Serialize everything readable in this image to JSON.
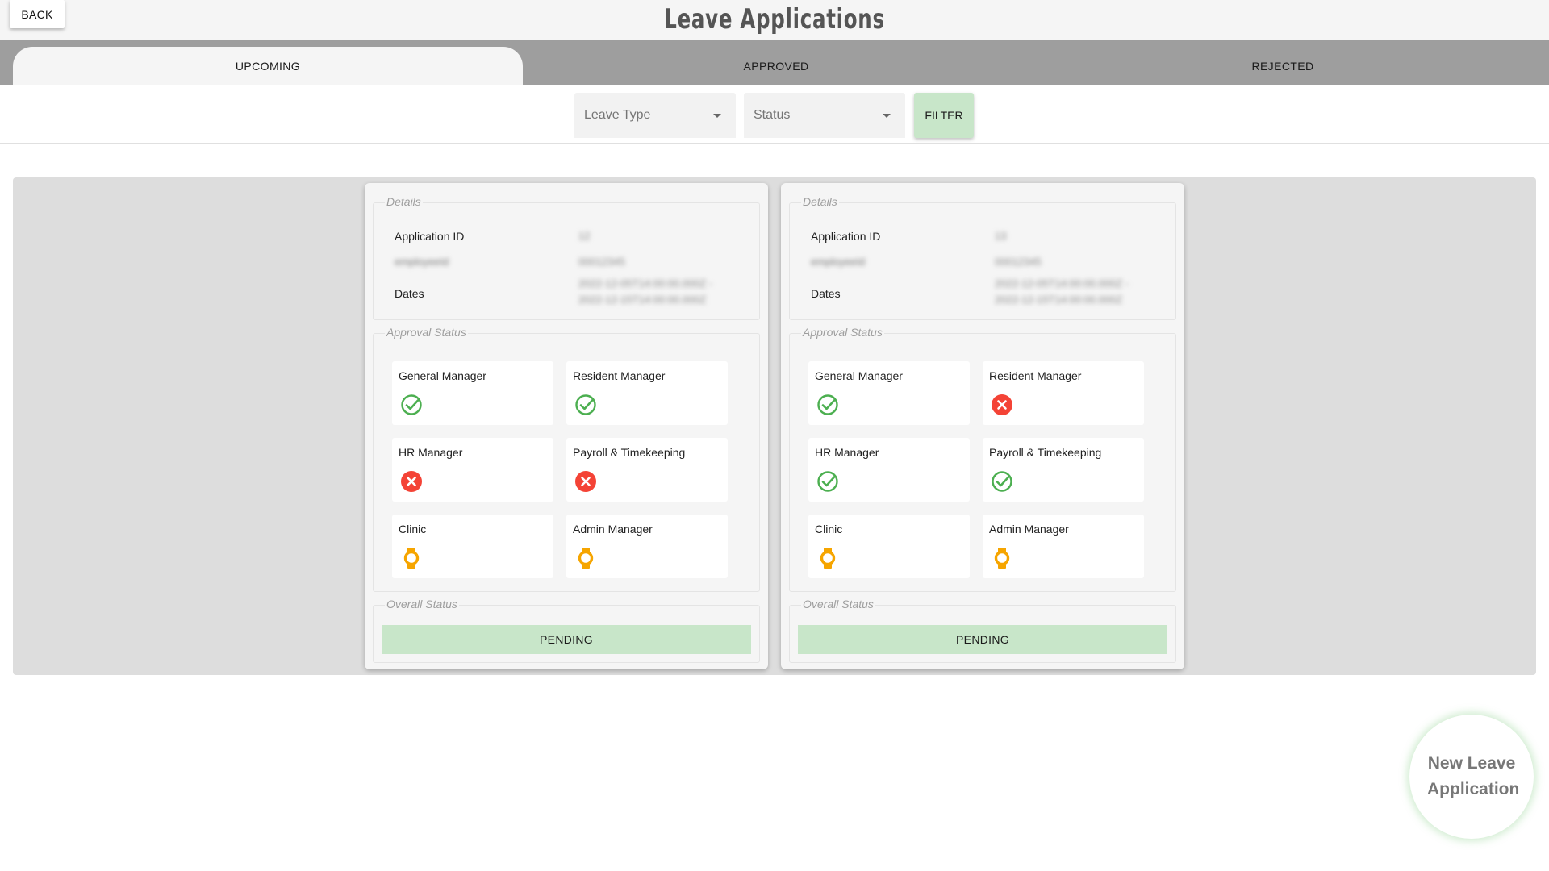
{
  "header": {
    "back_label": "BACK",
    "title": "Leave Applications"
  },
  "tabs": [
    {
      "label": "UPCOMING",
      "active": true
    },
    {
      "label": "APPROVED",
      "active": false
    },
    {
      "label": "REJECTED",
      "active": false
    }
  ],
  "filters": {
    "leave_type_placeholder": "Leave Type",
    "status_placeholder": "Status",
    "filter_label": "FILTER"
  },
  "colors": {
    "approved": "#4caf50",
    "rejected": "#f44336",
    "pending": "#f6a500",
    "accent_green": "#c8e6c9",
    "tabbar": "#9e9e9e"
  },
  "cards": [
    {
      "details_legend": "Details",
      "application_id_label": "Application ID",
      "application_id_value": "12",
      "employee_label": "employeeId",
      "employee_value": "00012345",
      "dates_label": "Dates",
      "dates_value_1": "2022-12-05T14:00:00.000Z -",
      "dates_value_2": "2022-12-15T14:00:00.000Z",
      "approval_legend": "Approval Status",
      "approvers": [
        {
          "role": "General Manager",
          "status": "approved",
          "icon": "check-circle-icon"
        },
        {
          "role": "Resident Manager",
          "status": "approved",
          "icon": "check-circle-icon"
        },
        {
          "role": "HR Manager",
          "status": "rejected",
          "icon": "cancel-icon"
        },
        {
          "role": "Payroll & Timekeeping",
          "status": "rejected",
          "icon": "cancel-icon"
        },
        {
          "role": "Clinic",
          "status": "pending",
          "icon": "watch-icon"
        },
        {
          "role": "Admin Manager",
          "status": "pending",
          "icon": "watch-icon"
        }
      ],
      "overall_legend": "Overall Status",
      "overall_status": "PENDING"
    },
    {
      "details_legend": "Details",
      "application_id_label": "Application ID",
      "application_id_value": "13",
      "employee_label": "employeeId",
      "employee_value": "00012345",
      "dates_label": "Dates",
      "dates_value_1": "2022-12-05T14:00:00.000Z -",
      "dates_value_2": "2022-12-15T14:00:00.000Z",
      "approval_legend": "Approval Status",
      "approvers": [
        {
          "role": "General Manager",
          "status": "approved",
          "icon": "check-circle-icon"
        },
        {
          "role": "Resident Manager",
          "status": "rejected",
          "icon": "cancel-icon"
        },
        {
          "role": "HR Manager",
          "status": "approved",
          "icon": "check-circle-icon"
        },
        {
          "role": "Payroll & Timekeeping",
          "status": "approved",
          "icon": "check-circle-icon"
        },
        {
          "role": "Clinic",
          "status": "pending",
          "icon": "watch-icon"
        },
        {
          "role": "Admin Manager",
          "status": "pending",
          "icon": "watch-icon"
        }
      ],
      "overall_legend": "Overall Status",
      "overall_status": "PENDING"
    }
  ],
  "fab": {
    "label": "New Leave Application"
  }
}
